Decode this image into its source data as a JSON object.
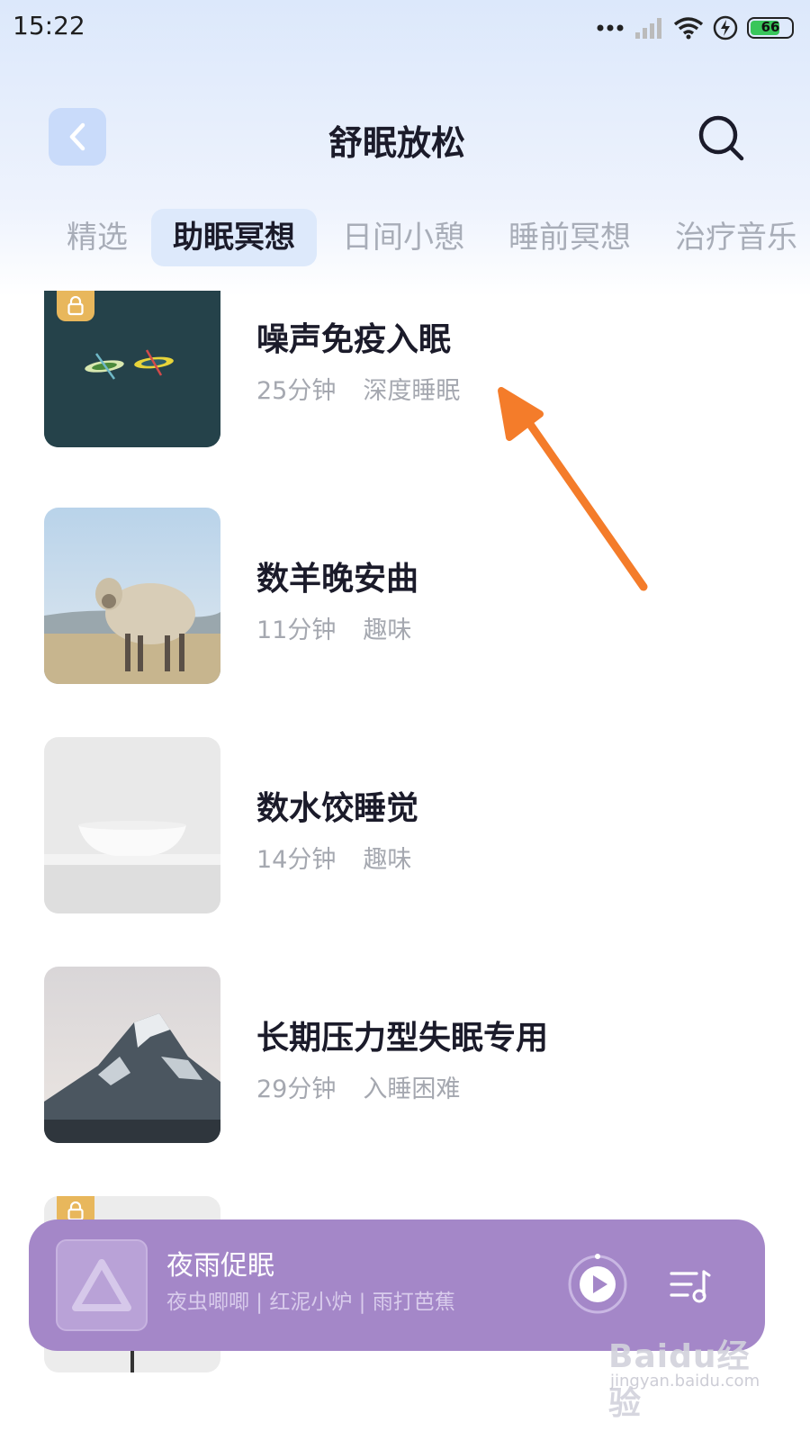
{
  "status_bar": {
    "time": "15:22",
    "battery": "66"
  },
  "header": {
    "title": "舒眠放松"
  },
  "tabs": [
    {
      "label": "精选"
    },
    {
      "label": "助眠冥想"
    },
    {
      "label": "日间小憩"
    },
    {
      "label": "睡前冥想"
    },
    {
      "label": "治疗音乐"
    }
  ],
  "items": [
    {
      "title": "噪声免疫入眠",
      "duration": "25分钟",
      "tag": "深度睡眠"
    },
    {
      "title": "数羊晚安曲",
      "duration": "11分钟",
      "tag": "趣味"
    },
    {
      "title": "数水饺睡觉",
      "duration": "14分钟",
      "tag": "趣味"
    },
    {
      "title": "长期压力型失眠专用",
      "duration": "29分钟",
      "tag": "入睡困难"
    }
  ],
  "player": {
    "title": "夜雨促眠",
    "subtitle": "夜虫唧唧 | 红泥小炉 | 雨打芭蕉"
  },
  "watermark": {
    "logo": "Baidu经验",
    "url": "jingyan.baidu.com"
  },
  "colors": {
    "accent_tab_bg": "#dde9fb",
    "player_bg": "#a487c8",
    "lock_badge": "#e8b75c",
    "annotation_arrow": "#f47c2a"
  }
}
